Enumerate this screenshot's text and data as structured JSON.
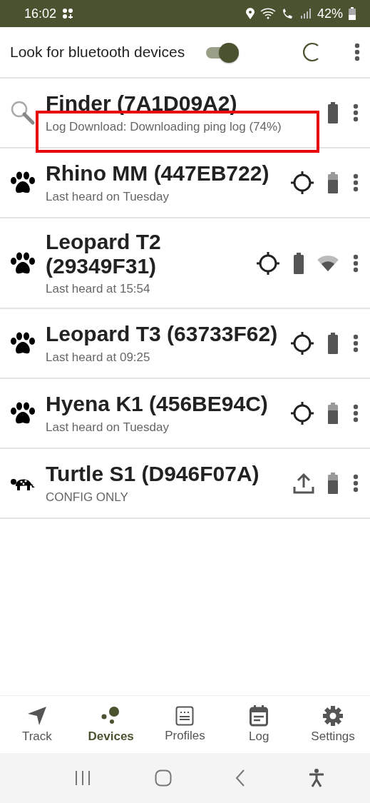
{
  "status_bar": {
    "time": "16:02",
    "battery_percent": "42%"
  },
  "header": {
    "label": "Look for bluetooth devices",
    "toggle_on": true
  },
  "devices": [
    {
      "kind": "finder",
      "title": "Finder (7A1D09A2)",
      "subtitle": "Log Download: Downloading ping log (74%)",
      "indicators": [
        {
          "kind": "battery_full"
        }
      ],
      "highlighted": true
    },
    {
      "kind": "paw",
      "title": "Rhino MM (447EB722)",
      "subtitle": "Last heard on Tuesday",
      "indicators": [
        {
          "kind": "locate"
        },
        {
          "kind": "battery_partial"
        }
      ],
      "highlighted": false
    },
    {
      "kind": "paw",
      "title": "Leopard T2 (29349F31)",
      "subtitle": "Last heard at 15:54",
      "indicators": [
        {
          "kind": "locate"
        },
        {
          "kind": "battery_full"
        },
        {
          "kind": "wifi"
        }
      ],
      "highlighted": false
    },
    {
      "kind": "paw",
      "title": "Leopard T3 (63733F62)",
      "subtitle": "Last heard at 09:25",
      "indicators": [
        {
          "kind": "locate"
        },
        {
          "kind": "battery_full"
        }
      ],
      "highlighted": false
    },
    {
      "kind": "paw",
      "title": "Hyena K1 (456BE94C)",
      "subtitle": "Last heard on Tuesday",
      "indicators": [
        {
          "kind": "locate"
        },
        {
          "kind": "battery_partial"
        }
      ],
      "highlighted": false
    },
    {
      "kind": "turtle",
      "title": "Turtle S1 (D946F07A)",
      "subtitle": "CONFIG ONLY",
      "indicators": [
        {
          "kind": "upload"
        },
        {
          "kind": "battery_partial"
        }
      ],
      "highlighted": false
    }
  ],
  "bottom_nav": [
    {
      "kind": "track",
      "label": "Track",
      "selected": false
    },
    {
      "kind": "devices",
      "label": "Devices",
      "selected": true
    },
    {
      "kind": "profiles",
      "label": "Profiles",
      "selected": false
    },
    {
      "kind": "log",
      "label": "Log",
      "selected": false
    },
    {
      "kind": "settings",
      "label": "Settings",
      "selected": false
    }
  ]
}
